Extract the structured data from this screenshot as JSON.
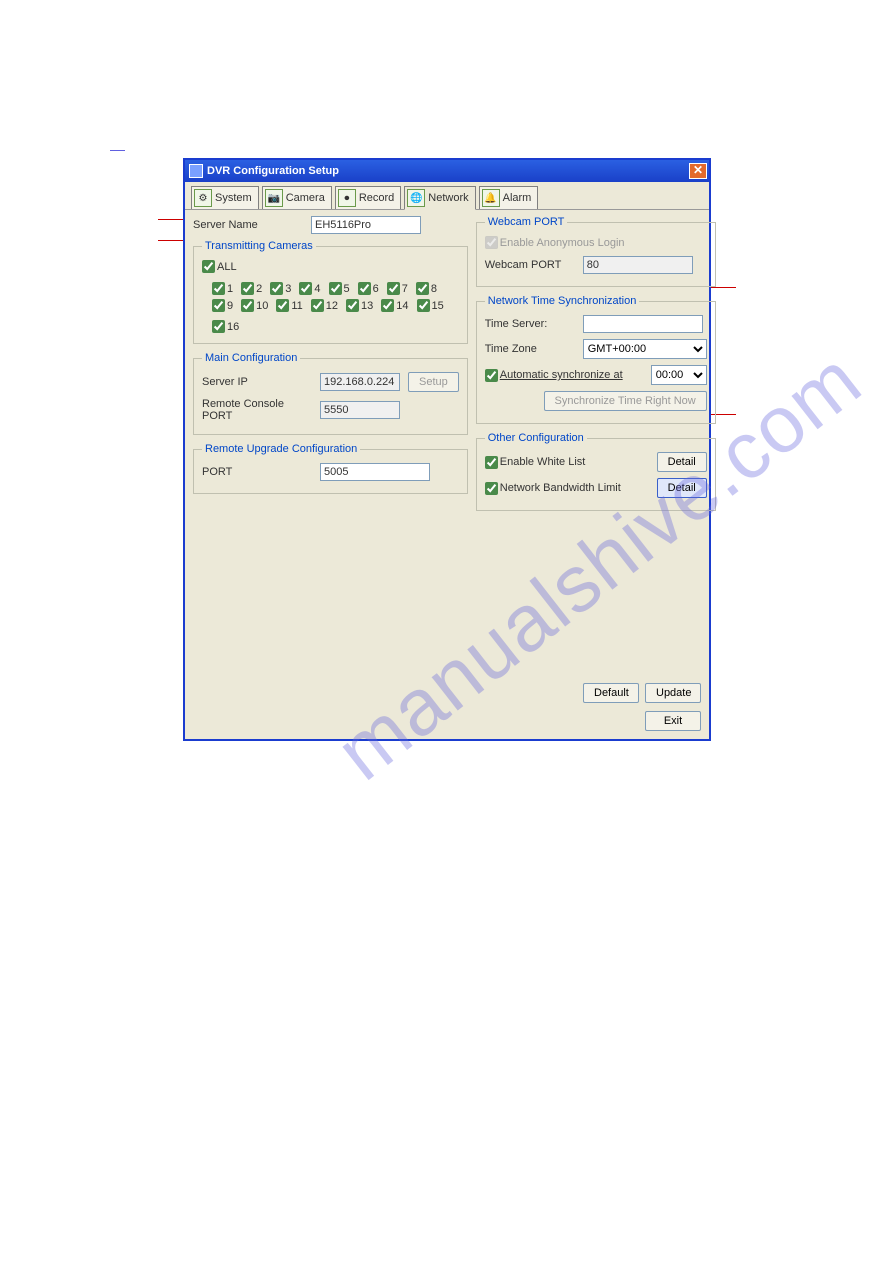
{
  "watermark": "manualshive.com",
  "window_title": "DVR Configuration Setup",
  "tabs": {
    "system": "System",
    "camera": "Camera",
    "record": "Record",
    "network": "Network",
    "alarm": "Alarm"
  },
  "server_name_label": "Server Name",
  "server_name_value": "EH5116Pro",
  "transmit_title": "Transmitting Cameras",
  "all_label": "ALL",
  "cams_row1": [
    "1",
    "2",
    "3",
    "4",
    "5",
    "6",
    "7",
    "8"
  ],
  "cams_row2": [
    "9",
    "10",
    "11",
    "12",
    "13",
    "14",
    "15",
    "16"
  ],
  "main_cfg_title": "Main Configuration",
  "server_ip_label": "Server IP",
  "server_ip_value": "192.168.0.224",
  "setup_label": "Setup",
  "remote_console_label": "Remote Console PORT",
  "remote_console_value": "5550",
  "remote_upgrade_title": "Remote Upgrade Configuration",
  "port_label": "PORT",
  "port_value": "5005",
  "webcam_title": "Webcam PORT",
  "anon_login_label": "Enable Anonymous Login",
  "webcam_port_label": "Webcam PORT",
  "webcam_port_value": "80",
  "ntp_title": "Network Time Synchronization",
  "time_server_label": "Time Server:",
  "time_server_value": "",
  "time_zone_label": "Time Zone",
  "time_zone_value": "GMT+00:00",
  "auto_sync_label": "Automatic synchronize at",
  "auto_sync_value": "00:00",
  "sync_now_label": "Synchronize Time Right Now",
  "other_title": "Other Configuration",
  "white_list_label": "Enable White List",
  "bandwidth_label": "Network Bandwidth Limit",
  "detail_label": "Detail",
  "default_label": "Default",
  "update_label": "Update",
  "exit_label": "Exit"
}
